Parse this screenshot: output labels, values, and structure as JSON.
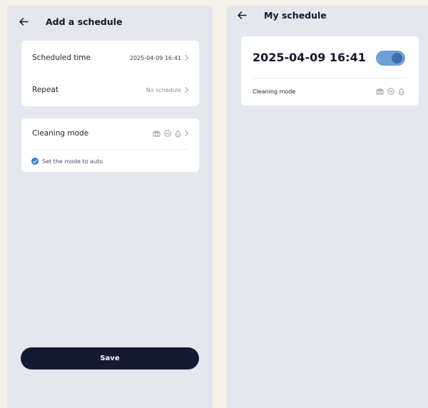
{
  "add_schedule": {
    "title": "Add a schedule",
    "scheduled_time_label": "Scheduled time",
    "scheduled_time_value": "2025-04-09 16:41",
    "repeat_label": "Repeat",
    "repeat_value": "No schedule",
    "cleaning_mode_label": "Cleaning mode",
    "auto_mode_text": "Set the mode to auto",
    "auto_mode_checked": true,
    "save_label": "Save"
  },
  "my_schedule": {
    "title": "My schedule",
    "time": "2025-04-09 16:41",
    "enabled": true,
    "cleaning_mode_label": "Cleaning mode"
  },
  "icons": {
    "back": "arrow-left-icon",
    "chevron": "chevron-right-icon",
    "mode_icons": [
      "mop-icon",
      "suction-icon",
      "water-drop-icon"
    ],
    "check": "check-circle-icon"
  },
  "colors": {
    "screen_bg": "#e4e7ed",
    "page_bg": "#f6f1e8",
    "card_bg": "#ffffff",
    "primary_dark": "#141a33",
    "accent_blue": "#3b7dd8",
    "toggle_track": "#6f9fd4",
    "toggle_knob": "#3a6fb0"
  }
}
